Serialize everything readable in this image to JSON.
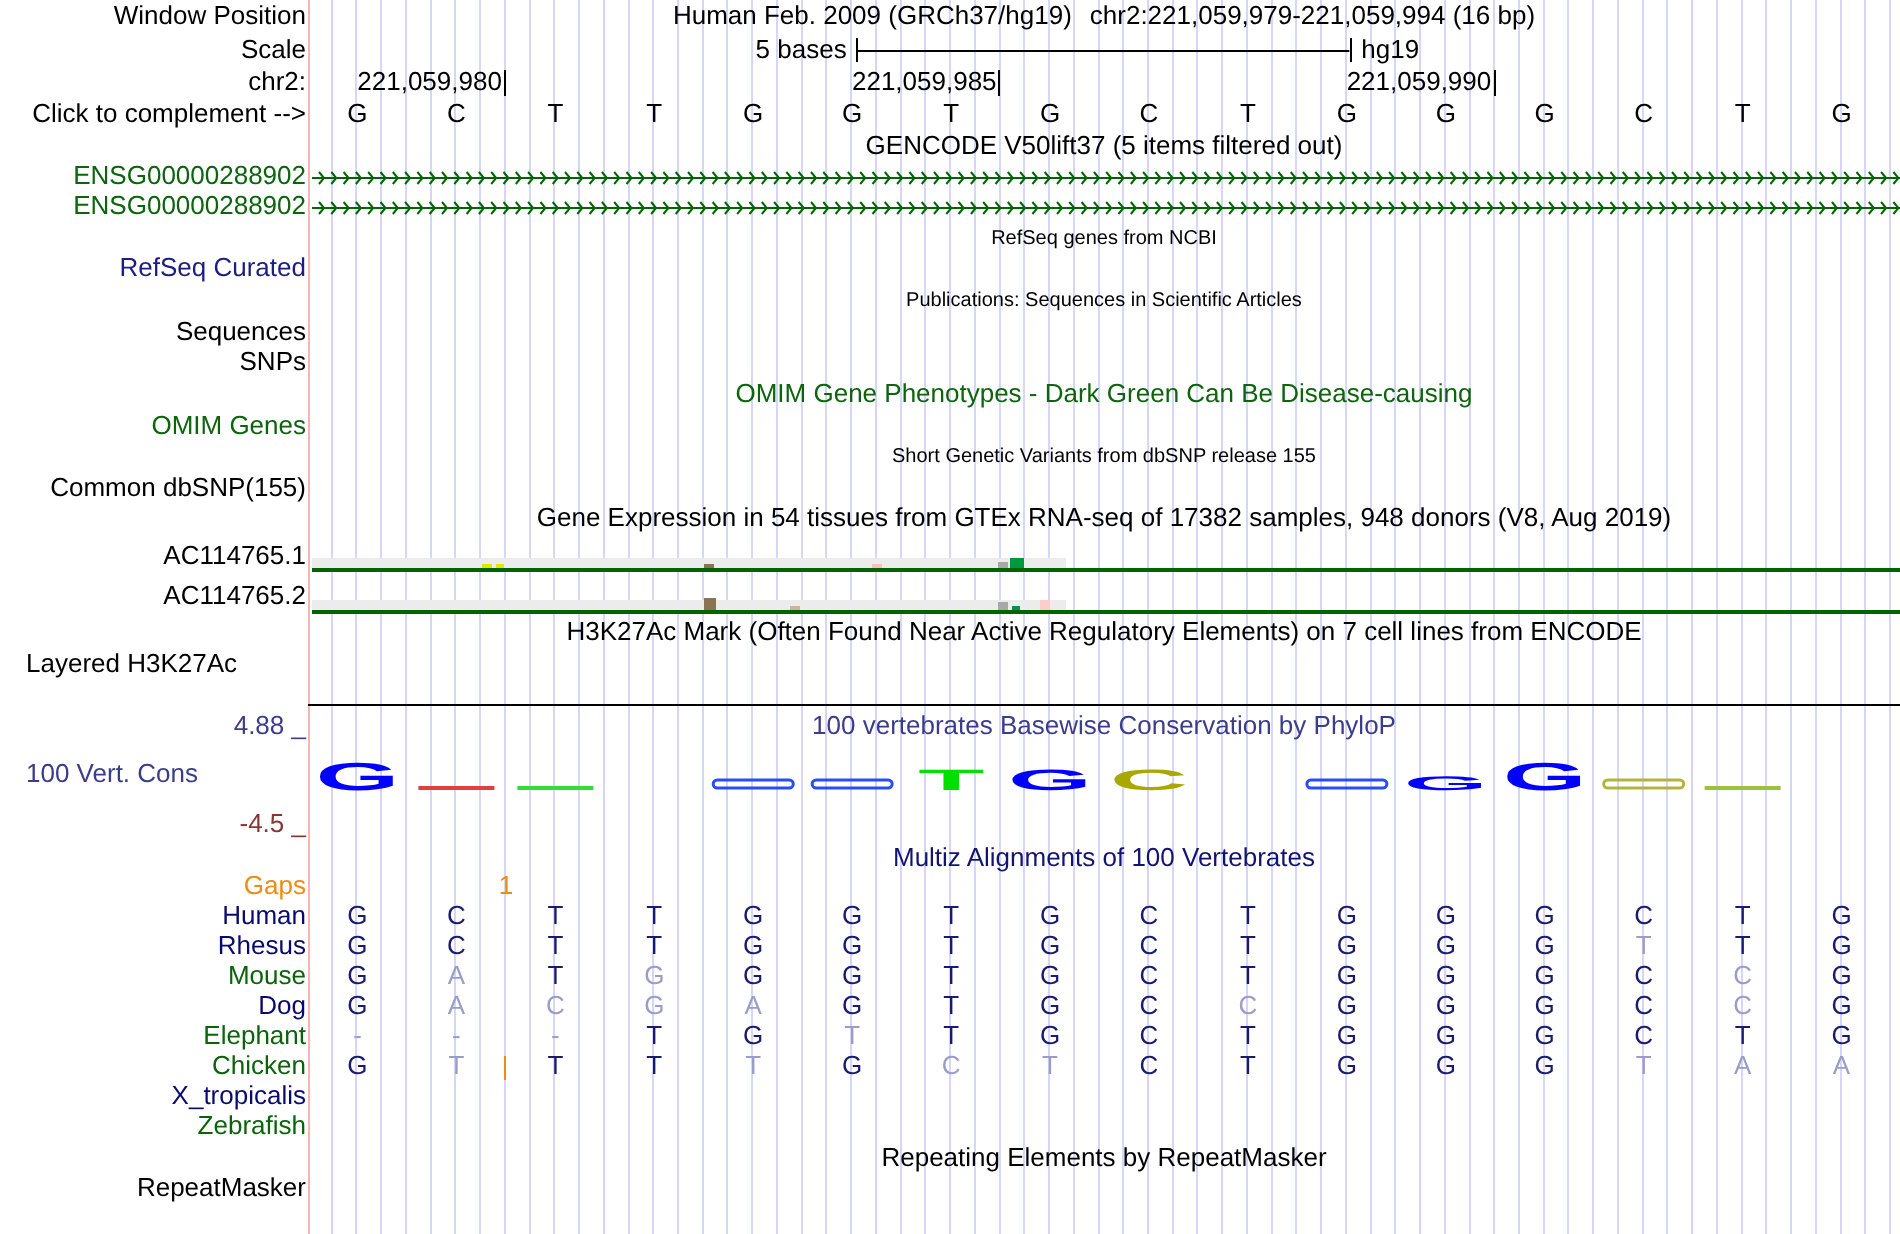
{
  "header": {
    "label": "Window Position",
    "assembly": "Human Feb. 2009 (GRCh37/hg19)",
    "position": "chr2:221,059,979-221,059,994 (16 bp)"
  },
  "scale": {
    "label": "Scale",
    "length": "5 bases",
    "assembly": "hg19"
  },
  "ruler": {
    "label": "chr2:",
    "ticks": [
      "221,059,980",
      "221,059,985",
      "221,059,990"
    ]
  },
  "sequence": {
    "label": "Click to complement -->",
    "bases": [
      "G",
      "C",
      "T",
      "T",
      "G",
      "G",
      "T",
      "G",
      "C",
      "T",
      "G",
      "G",
      "G",
      "C",
      "T",
      "G"
    ]
  },
  "gencode": {
    "title": "GENCODE V50lift37 (5 items filtered out)",
    "genes": [
      {
        "name": "ENSG00000288902"
      },
      {
        "name": "ENSG00000288902"
      }
    ]
  },
  "refseq": {
    "title": "RefSeq genes from NCBI",
    "label": "RefSeq Curated"
  },
  "publications": {
    "title": "Publications: Sequences in Scientific Articles",
    "labels": [
      "Sequences",
      "SNPs"
    ]
  },
  "omim": {
    "title": "OMIM Gene Phenotypes - Dark Green Can Be Disease-causing",
    "label": "OMIM Genes"
  },
  "dbsnp": {
    "title": "Short Genetic Variants from dbSNP release 155",
    "label": "Common dbSNP(155)"
  },
  "gtex": {
    "title": "Gene Expression in 54 tissues from GTEx RNA-seq of 17382 samples, 948 donors (V8, Aug 2019)",
    "genes": [
      {
        "name": "AC114765.1"
      },
      {
        "name": "AC114765.2"
      }
    ]
  },
  "h3k27ac": {
    "title": "H3K27Ac Mark (Often Found Near Active Regulatory Elements) on 7 cell lines from ENCODE",
    "label": "Layered H3K27Ac"
  },
  "conservation": {
    "title": "100 vertebrates Basewise Conservation by PhyloP",
    "label": "100 Vert. Cons",
    "max": "4.88 _",
    "min": "-4.5 _",
    "logo": [
      {
        "marks": [
          {
            "kind": "tall",
            "base": "G",
            "color": "#0000ff"
          },
          {
            "kind": "flat",
            "color": "#e04040"
          },
          {
            "kind": "flat",
            "color": "#33dd33"
          }
        ]
      },
      {
        "marks": [
          {
            "kind": "low",
            "color": "#2a4cff"
          },
          {
            "kind": "low",
            "color": "#2a4cff"
          },
          {
            "kind": "mid",
            "base": "T",
            "color": "#00e000"
          },
          {
            "kind": "mid",
            "base": "G",
            "color": "#0000ff"
          },
          {
            "kind": "mid",
            "base": "C",
            "color": "#a8a800"
          }
        ]
      },
      {
        "marks": [
          {
            "kind": "low",
            "color": "#2a4cff"
          },
          {
            "kind": "short",
            "base": "G",
            "color": "#0000ff"
          },
          {
            "kind": "tall",
            "base": "G",
            "color": "#0000ff"
          },
          {
            "kind": "low",
            "color": "#b4b43c"
          },
          {
            "kind": "flat",
            "color": "#9cc040"
          }
        ]
      }
    ]
  },
  "multiz": {
    "title": "Multiz Alignments of 100 Vertebrates",
    "gaps": {
      "label": "Gaps",
      "count": "1"
    },
    "species": [
      {
        "name": "Human",
        "color": "#0a0a6e",
        "bases": [
          {
            "base": "G",
            "differs": false,
            "insertion": false
          },
          {
            "base": "C",
            "differs": false,
            "insertion": false
          },
          {
            "base": "T",
            "differs": false,
            "insertion": false
          },
          {
            "base": "T",
            "differs": false,
            "insertion": false
          },
          {
            "base": "G",
            "differs": false,
            "insertion": false
          },
          {
            "base": "G",
            "differs": false,
            "insertion": false
          },
          {
            "base": "T",
            "differs": false,
            "insertion": false
          },
          {
            "base": "G",
            "differs": false,
            "insertion": false
          },
          {
            "base": "C",
            "differs": false,
            "insertion": false
          },
          {
            "base": "T",
            "differs": false,
            "insertion": false
          },
          {
            "base": "G",
            "differs": false,
            "insertion": false
          },
          {
            "base": "G",
            "differs": false,
            "insertion": false
          },
          {
            "base": "G",
            "differs": false,
            "insertion": false
          },
          {
            "base": "C",
            "differs": false,
            "insertion": false
          },
          {
            "base": "T",
            "differs": false,
            "insertion": false
          },
          {
            "base": "G",
            "differs": false,
            "insertion": false
          }
        ]
      },
      {
        "name": "Rhesus",
        "color": "#0a0a6e",
        "bases": [
          {
            "base": "G",
            "differs": false,
            "insertion": false
          },
          {
            "base": "C",
            "differs": false,
            "insertion": false
          },
          {
            "base": "T",
            "differs": false,
            "insertion": false
          },
          {
            "base": "T",
            "differs": false,
            "insertion": false
          },
          {
            "base": "G",
            "differs": false,
            "insertion": false
          },
          {
            "base": "G",
            "differs": false,
            "insertion": false
          },
          {
            "base": "T",
            "differs": false,
            "insertion": false
          },
          {
            "base": "G",
            "differs": false,
            "insertion": false
          },
          {
            "base": "C",
            "differs": false,
            "insertion": false
          },
          {
            "base": "T",
            "differs": false,
            "insertion": false
          },
          {
            "base": "G",
            "differs": false,
            "insertion": false
          },
          {
            "base": "G",
            "differs": false,
            "insertion": false
          },
          {
            "base": "G",
            "differs": false,
            "insertion": false
          },
          {
            "base": "T",
            "differs": true,
            "insertion": false
          },
          {
            "base": "T",
            "differs": false,
            "insertion": false
          },
          {
            "base": "G",
            "differs": false,
            "insertion": false
          }
        ]
      },
      {
        "name": "Mouse",
        "color": "#0a640a",
        "bases": [
          {
            "base": "G",
            "differs": false,
            "insertion": false
          },
          {
            "base": "A",
            "differs": true,
            "insertion": false
          },
          {
            "base": "T",
            "differs": false,
            "insertion": false
          },
          {
            "base": "G",
            "differs": true,
            "insertion": false
          },
          {
            "base": "G",
            "differs": false,
            "insertion": false
          },
          {
            "base": "G",
            "differs": false,
            "insertion": false
          },
          {
            "base": "T",
            "differs": false,
            "insertion": false
          },
          {
            "base": "G",
            "differs": false,
            "insertion": false
          },
          {
            "base": "C",
            "differs": false,
            "insertion": false
          },
          {
            "base": "T",
            "differs": false,
            "insertion": false
          },
          {
            "base": "G",
            "differs": false,
            "insertion": false
          },
          {
            "base": "G",
            "differs": false,
            "insertion": false
          },
          {
            "base": "G",
            "differs": false,
            "insertion": false
          },
          {
            "base": "C",
            "differs": false,
            "insertion": false
          },
          {
            "base": "C",
            "differs": true,
            "insertion": false
          },
          {
            "base": "G",
            "differs": false,
            "insertion": false
          }
        ]
      },
      {
        "name": "Dog",
        "color": "#0a0a6e",
        "bases": [
          {
            "base": "G",
            "differs": false,
            "insertion": false
          },
          {
            "base": "A",
            "differs": true,
            "insertion": false
          },
          {
            "base": "C",
            "differs": true,
            "insertion": false
          },
          {
            "base": "G",
            "differs": true,
            "insertion": false
          },
          {
            "base": "A",
            "differs": true,
            "insertion": false
          },
          {
            "base": "G",
            "differs": false,
            "insertion": false
          },
          {
            "base": "T",
            "differs": false,
            "insertion": false
          },
          {
            "base": "G",
            "differs": false,
            "insertion": false
          },
          {
            "base": "C",
            "differs": false,
            "insertion": false
          },
          {
            "base": "C",
            "differs": true,
            "insertion": false
          },
          {
            "base": "G",
            "differs": false,
            "insertion": false
          },
          {
            "base": "G",
            "differs": false,
            "insertion": false
          },
          {
            "base": "G",
            "differs": false,
            "insertion": false
          },
          {
            "base": "C",
            "differs": false,
            "insertion": false
          },
          {
            "base": "C",
            "differs": true,
            "insertion": false
          },
          {
            "base": "G",
            "differs": false,
            "insertion": false
          }
        ]
      },
      {
        "name": "Elephant",
        "color": "#0a640a",
        "bases": [
          {
            "base": "-",
            "differs": true,
            "insertion": false
          },
          {
            "base": "-",
            "differs": true,
            "insertion": false
          },
          {
            "base": "-",
            "differs": true,
            "insertion": false
          },
          {
            "base": "T",
            "differs": false,
            "insertion": false
          },
          {
            "base": "G",
            "differs": false,
            "insertion": false
          },
          {
            "base": "T",
            "differs": true,
            "insertion": false
          },
          {
            "base": "T",
            "differs": false,
            "insertion": false
          },
          {
            "base": "G",
            "differs": false,
            "insertion": false
          },
          {
            "base": "C",
            "differs": false,
            "insertion": false
          },
          {
            "base": "T",
            "differs": false,
            "insertion": false
          },
          {
            "base": "G",
            "differs": false,
            "insertion": false
          },
          {
            "base": "G",
            "differs": false,
            "insertion": false
          },
          {
            "base": "G",
            "differs": false,
            "insertion": false
          },
          {
            "base": "C",
            "differs": false,
            "insertion": false
          },
          {
            "base": "T",
            "differs": false,
            "insertion": false
          },
          {
            "base": "G",
            "differs": false,
            "insertion": false
          }
        ]
      },
      {
        "name": "Chicken",
        "color": "#0a640a",
        "bases": [
          {
            "base": "G",
            "differs": false,
            "insertion": false
          },
          {
            "base": "T",
            "differs": true,
            "insertion": true
          },
          {
            "base": "T",
            "differs": false,
            "insertion": false
          },
          {
            "base": "T",
            "differs": false,
            "insertion": false
          },
          {
            "base": "T",
            "differs": true,
            "insertion": false
          },
          {
            "base": "G",
            "differs": false,
            "insertion": false
          },
          {
            "base": "C",
            "differs": true,
            "insertion": false
          },
          {
            "base": "T",
            "differs": true,
            "insertion": false
          },
          {
            "base": "C",
            "differs": false,
            "insertion": false
          },
          {
            "base": "T",
            "differs": false,
            "insertion": false
          },
          {
            "base": "G",
            "differs": false,
            "insertion": false
          },
          {
            "base": "G",
            "differs": false,
            "insertion": false
          },
          {
            "base": "G",
            "differs": false,
            "insertion": false
          },
          {
            "base": "T",
            "differs": true,
            "insertion": false
          },
          {
            "base": "A",
            "differs": true,
            "insertion": false
          },
          {
            "base": "A",
            "differs": true,
            "insertion": false
          }
        ]
      },
      {
        "name": "X_tropicalis",
        "color": "#0a0a6e"
      },
      {
        "name": "Zebrafish",
        "color": "#0a640a"
      }
    ]
  },
  "repeatmasker": {
    "title": "Repeating Elements by RepeatMasker",
    "label": "RepeatMasker"
  }
}
